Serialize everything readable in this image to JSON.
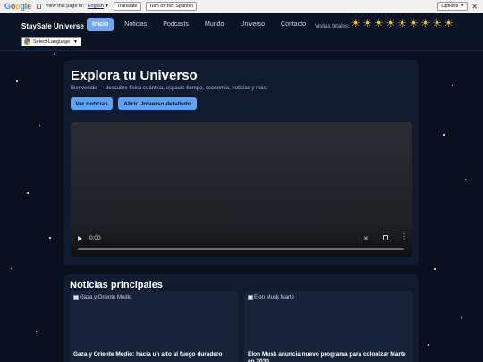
{
  "translate_bar": {
    "logo": "Google",
    "prompt": "View this page in:",
    "language": "English",
    "translate_label": "Translate",
    "turn_off_label": "Turn off for: Spanish",
    "options_label": "Options ▼",
    "close_glyph": "✕"
  },
  "header": {
    "brand": "StaySafe Universe",
    "nav": [
      "Inicio",
      "Noticias",
      "Podcasts",
      "Mundo",
      "Universo",
      "Contacto"
    ],
    "active_nav": "Inicio",
    "visits_label": "Visitas totales:",
    "visit_suns": [
      "☀",
      "☀",
      "☀",
      "☀",
      "☀",
      "☀",
      "☀",
      "☀",
      "☀"
    ],
    "language_select": "Select Language"
  },
  "hero": {
    "title": "Explora tu Universo",
    "subtitle": "Bienvenido — descubre física cuántica, espacio-tiempo, economía, noticias y más.",
    "btn_news": "Ver noticias",
    "btn_universe": "Abrir Universo detallado",
    "video": {
      "time": "0:00",
      "progress": 0
    }
  },
  "news": {
    "title": "Noticias principales",
    "cards": [
      {
        "img_alt": "Gaza y Oriente Medio",
        "headline": "Gaza y Oriente Medio: hacia un alto al fuego duradero"
      },
      {
        "img_alt": "Elon Musk Marte",
        "headline": "Elon Musk anuncia nuevo programa para colonizar Marte en 2030"
      }
    ]
  },
  "colors": {
    "accent": "#5fa2f5",
    "background": "#0a1020",
    "card": "#111b30",
    "sun": "#f6c61a"
  }
}
